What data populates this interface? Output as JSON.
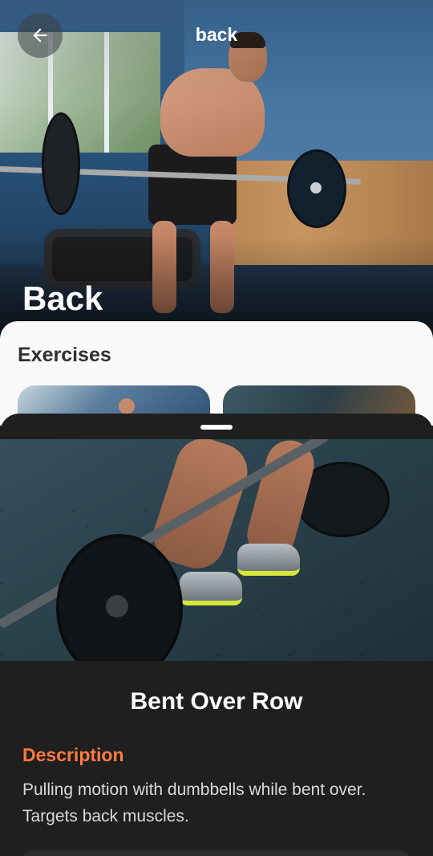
{
  "header": {
    "title": "back",
    "back_icon": "arrow-left-icon"
  },
  "hero": {
    "title": "Back"
  },
  "content": {
    "section_title": "Exercises"
  },
  "sheet": {
    "exercise_title": "Bent Over Row",
    "description_heading": "Description",
    "description_text": "Pulling motion with dumbbells while bent over. Targets back muscles."
  },
  "colors": {
    "accent": "#ff7a3d",
    "sheet_background": "#1f1f1f",
    "card_background": "#fafafa"
  }
}
